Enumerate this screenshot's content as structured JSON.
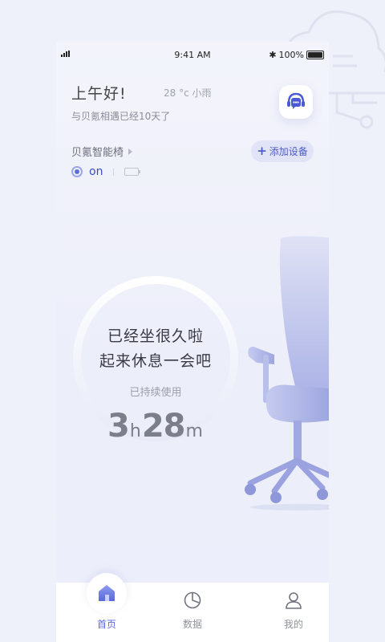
{
  "status_bar": {
    "time": "9:41 AM",
    "battery": "100%"
  },
  "header": {
    "greeting": "上午好!",
    "weather": "28 °c 小雨",
    "days_together": "与贝氪相遇已经10天了"
  },
  "device": {
    "name": "贝氪智能椅",
    "add_label": "添加设备",
    "status": "on"
  },
  "reminder": {
    "line1": "已经坐很久啦",
    "line2": "起来休息一会吧",
    "duration_label": "已持续使用",
    "hours": "3",
    "hours_unit": "h",
    "minutes": "28",
    "minutes_unit": "m"
  },
  "tabs": [
    {
      "label": "首页",
      "icon": "home-icon",
      "active": true
    },
    {
      "label": "数据",
      "icon": "pie-chart-icon",
      "active": false
    },
    {
      "label": "我的",
      "icon": "user-icon",
      "active": false
    }
  ],
  "colors": {
    "accent": "#5b6ae0",
    "background": "#eef0fa"
  }
}
